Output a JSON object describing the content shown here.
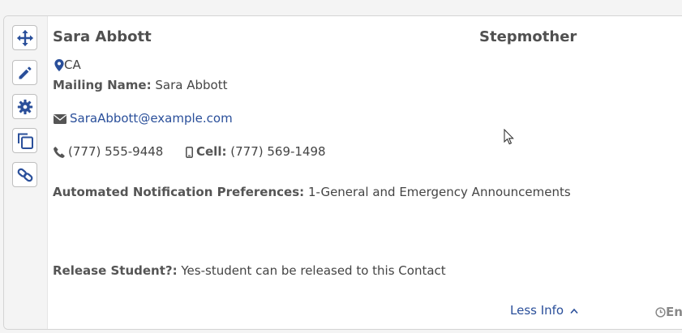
{
  "contact": {
    "name": "Sara Abbott",
    "relationship": "Stepmother",
    "location": "CA",
    "mailing_name_label": "Mailing Name:",
    "mailing_name": "Sara Abbott",
    "email": "SaraAbbott@example.com",
    "phone": "(777) 555-9448",
    "cell_label": "Cell:",
    "cell": "(777) 569-1498",
    "notification_label": "Automated Notification Preferences:",
    "notification_value": "1-General and Emergency Announcements",
    "release_label": "Release Student?:",
    "release_value": "Yes-student can be released to this Contact"
  },
  "footer": {
    "less_info": "Less Info",
    "enter_stub": "En"
  },
  "toolbar": {
    "icons": [
      "move-icon",
      "pencil-icon",
      "gear-icon",
      "copy-icon",
      "link-icon"
    ]
  },
  "colors": {
    "accent": "#2a4f9a",
    "text": "#444444",
    "panel": "#f4f4f4"
  }
}
